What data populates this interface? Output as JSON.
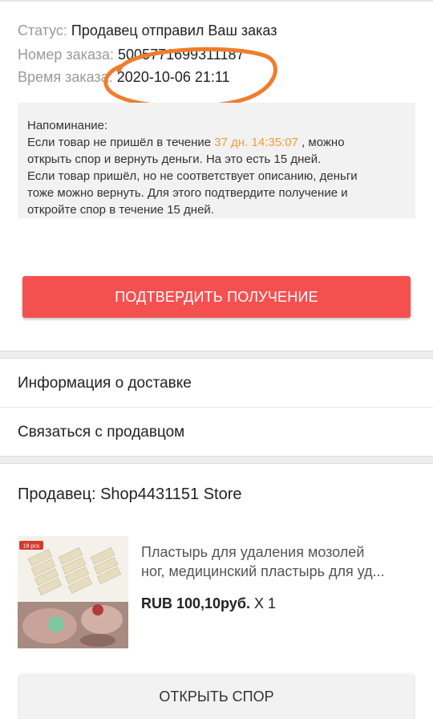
{
  "order": {
    "status_label": "Статус:",
    "status_value": "Продавец отправил Ваш заказ",
    "number_label": "Номер заказа:",
    "number_value": "5005771699311187",
    "time_label": "Время заказа:",
    "time_value": "2020-10-06 21:11"
  },
  "reminder": {
    "title": "Напоминание:",
    "line1_pre": "Если товар не пришёл в течение ",
    "countdown": "37 дн. 14:35:07",
    "line1_post": " , можно",
    "line2": "открыть спор и вернуть деньги. На это есть 15 дней.",
    "line3": "Если товар пришёл, но не соответствует описанию, деньги",
    "line4": "тоже можно вернуть. Для этого подтвердите получение и",
    "line5": "откройте спор в течение 15 дней."
  },
  "actions": {
    "confirm_label": "ПОДТВЕРДИТЬ ПОЛУЧЕНИЕ",
    "dispute_label": "ОТКРЫТЬ СПОР"
  },
  "menu": {
    "delivery": "Информация о доставке",
    "contact": "Связаться с продавцом"
  },
  "seller": {
    "label": "Продавец: Shop4431151 Store"
  },
  "product": {
    "badge": "18 pcs",
    "title_line1": "Пластырь для удаления мозолей",
    "title_line2": "ног, медицинский пластырь для уд...",
    "price": "RUB 100,10руб.",
    "qty": "X 1"
  },
  "colors": {
    "accent": "#f55050",
    "countdown": "#f29c38",
    "annotation": "#f07d2c"
  }
}
